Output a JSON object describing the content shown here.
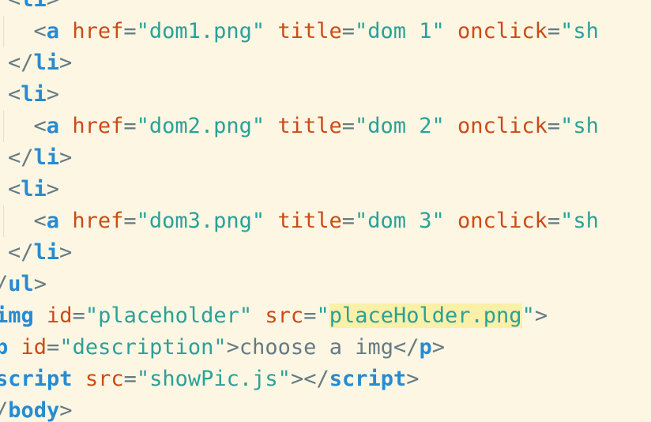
{
  "editor": {
    "theme": "solarized-light",
    "colors": {
      "background": "#fdf6e3",
      "tag": "#268bd2",
      "attribute": "#cb4b16",
      "string": "#2aa198",
      "punctuation": "#657b83",
      "highlight": "#fbf0a8"
    },
    "lines": [
      {
        "id": "line-li-open-0",
        "tokens": [
          {
            "t": "punct",
            "v": "<"
          },
          {
            "t": "tag",
            "v": "li"
          },
          {
            "t": "punct",
            "v": ">"
          }
        ]
      },
      {
        "id": "line-a-dom1",
        "tokens": [
          {
            "t": "punct",
            "v": "  <"
          },
          {
            "t": "tag",
            "v": "a"
          },
          {
            "t": "punct",
            "v": " "
          },
          {
            "t": "attr",
            "v": "href"
          },
          {
            "t": "punct",
            "v": "="
          },
          {
            "t": "str",
            "v": "\"dom1.png\""
          },
          {
            "t": "punct",
            "v": " "
          },
          {
            "t": "attr",
            "v": "title"
          },
          {
            "t": "punct",
            "v": "="
          },
          {
            "t": "str",
            "v": "\"dom 1\""
          },
          {
            "t": "punct",
            "v": " "
          },
          {
            "t": "attr",
            "v": "onclick"
          },
          {
            "t": "punct",
            "v": "="
          },
          {
            "t": "str",
            "v": "\"sh"
          }
        ]
      },
      {
        "id": "line-li-close-1",
        "tokens": [
          {
            "t": "punct",
            "v": "</"
          },
          {
            "t": "tag",
            "v": "li"
          },
          {
            "t": "punct",
            "v": ">"
          }
        ]
      },
      {
        "id": "line-li-open-2",
        "tokens": [
          {
            "t": "punct",
            "v": "<"
          },
          {
            "t": "tag",
            "v": "li"
          },
          {
            "t": "punct",
            "v": ">"
          }
        ]
      },
      {
        "id": "line-a-dom2",
        "tokens": [
          {
            "t": "punct",
            "v": "  <"
          },
          {
            "t": "tag",
            "v": "a"
          },
          {
            "t": "punct",
            "v": " "
          },
          {
            "t": "attr",
            "v": "href"
          },
          {
            "t": "punct",
            "v": "="
          },
          {
            "t": "str",
            "v": "\"dom2.png\""
          },
          {
            "t": "punct",
            "v": " "
          },
          {
            "t": "attr",
            "v": "title"
          },
          {
            "t": "punct",
            "v": "="
          },
          {
            "t": "str",
            "v": "\"dom 2\""
          },
          {
            "t": "punct",
            "v": " "
          },
          {
            "t": "attr",
            "v": "onclick"
          },
          {
            "t": "punct",
            "v": "="
          },
          {
            "t": "str",
            "v": "\"sh"
          }
        ]
      },
      {
        "id": "line-li-close-2",
        "tokens": [
          {
            "t": "punct",
            "v": "</"
          },
          {
            "t": "tag",
            "v": "li"
          },
          {
            "t": "punct",
            "v": ">"
          }
        ]
      },
      {
        "id": "line-li-open-3",
        "tokens": [
          {
            "t": "punct",
            "v": "<"
          },
          {
            "t": "tag",
            "v": "li"
          },
          {
            "t": "punct",
            "v": ">"
          }
        ]
      },
      {
        "id": "line-a-dom3",
        "tokens": [
          {
            "t": "punct",
            "v": "  <"
          },
          {
            "t": "tag",
            "v": "a"
          },
          {
            "t": "punct",
            "v": " "
          },
          {
            "t": "attr",
            "v": "href"
          },
          {
            "t": "punct",
            "v": "="
          },
          {
            "t": "str",
            "v": "\"dom3.png\""
          },
          {
            "t": "punct",
            "v": " "
          },
          {
            "t": "attr",
            "v": "title"
          },
          {
            "t": "punct",
            "v": "="
          },
          {
            "t": "str",
            "v": "\"dom 3\""
          },
          {
            "t": "punct",
            "v": " "
          },
          {
            "t": "attr",
            "v": "onclick"
          },
          {
            "t": "punct",
            "v": "="
          },
          {
            "t": "str",
            "v": "\"sh"
          }
        ]
      },
      {
        "id": "line-li-close-3",
        "tokens": [
          {
            "t": "punct",
            "v": "</"
          },
          {
            "t": "tag",
            "v": "li"
          },
          {
            "t": "punct",
            "v": ">"
          }
        ]
      },
      {
        "id": "line-ul-close",
        "tokens": [
          {
            "t": "punct",
            "v": "/"
          },
          {
            "t": "tag",
            "v": "ul"
          },
          {
            "t": "punct",
            "v": ">"
          }
        ]
      },
      {
        "id": "line-img",
        "tokens": [
          {
            "t": "tag",
            "v": "img"
          },
          {
            "t": "punct",
            "v": " "
          },
          {
            "t": "attr",
            "v": "id"
          },
          {
            "t": "punct",
            "v": "="
          },
          {
            "t": "str",
            "v": "\"placeholder\""
          },
          {
            "t": "punct",
            "v": " "
          },
          {
            "t": "attr",
            "v": "src"
          },
          {
            "t": "punct",
            "v": "="
          },
          {
            "t": "str",
            "v": "\""
          },
          {
            "t": "str",
            "v": "placeHolder.png",
            "hl": true
          },
          {
            "t": "str",
            "v": "\""
          },
          {
            "t": "punct",
            "v": ">"
          }
        ]
      },
      {
        "id": "line-p",
        "tokens": [
          {
            "t": "tag",
            "v": "p"
          },
          {
            "t": "punct",
            "v": " "
          },
          {
            "t": "attr",
            "v": "id"
          },
          {
            "t": "punct",
            "v": "="
          },
          {
            "t": "str",
            "v": "\"description\""
          },
          {
            "t": "punct",
            "v": ">"
          },
          {
            "t": "text",
            "v": "choose a img"
          },
          {
            "t": "punct",
            "v": "</"
          },
          {
            "t": "tag",
            "v": "p"
          },
          {
            "t": "punct",
            "v": ">"
          }
        ]
      },
      {
        "id": "line-script",
        "tokens": [
          {
            "t": "tag",
            "v": "script"
          },
          {
            "t": "punct",
            "v": " "
          },
          {
            "t": "attr",
            "v": "src"
          },
          {
            "t": "punct",
            "v": "="
          },
          {
            "t": "str",
            "v": "\"showPic.js\""
          },
          {
            "t": "punct",
            "v": "></"
          },
          {
            "t": "tag",
            "v": "script"
          },
          {
            "t": "punct",
            "v": ">"
          }
        ]
      },
      {
        "id": "line-body-close",
        "tokens": [
          {
            "t": "punct",
            "v": "/"
          },
          {
            "t": "tag",
            "v": "body"
          },
          {
            "t": "punct",
            "v": ">"
          }
        ]
      }
    ]
  }
}
